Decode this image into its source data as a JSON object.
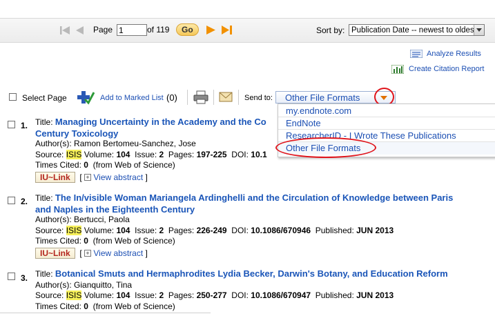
{
  "pagination": {
    "page_label": "Page",
    "page_value": "1",
    "of_label": "of 119",
    "go_label": "Go"
  },
  "sort": {
    "label": "Sort by:",
    "selected": "Publication Date -- newest to oldest"
  },
  "tools": {
    "analyze_results": "Analyze Results",
    "create_citation_report": "Create Citation Report"
  },
  "toolbar": {
    "select_page": "Select Page",
    "add_to_marked_list": "Add to Marked List",
    "marked_count": "(0)",
    "send_to_label": "Send to:",
    "send_to_value": "Other File Formats"
  },
  "send_to_menu": {
    "items": [
      "my.endnote.com",
      "EndNote",
      "ResearcherID - I Wrote These Publications",
      "Other File Formats"
    ]
  },
  "results": [
    {
      "number": "1.",
      "title_label": "Title:",
      "title_line1": "Managing Uncertainty in the Academy and the Co",
      "title_line2": "Century Toxicology",
      "authors_label": "Author(s):",
      "authors": "Ramon Bertomeu-Sanchez, Jose",
      "source_label": "Source:",
      "source": "ISIS",
      "volume_label": "Volume:",
      "volume": "104",
      "issue_label": "Issue:",
      "issue": "2",
      "pages_label": "Pages:",
      "pages": "197-225",
      "doi_label": "DOI:",
      "doi": "10.1",
      "doi_rest": "",
      "published_label": "",
      "published": "",
      "times_cited_label": "Times Cited:",
      "times_cited": "0",
      "times_cited_note": "(from Web of Science)",
      "iu_link": "IU~Link",
      "view_abstract": "View abstract"
    },
    {
      "number": "2.",
      "title_label": "Title:",
      "title_line1": "The In/visible Woman Mariangela Ardinghelli and the Circulation of Knowledge between Paris",
      "title_line2": "and Naples in the Eighteenth Century",
      "authors_label": "Author(s):",
      "authors": "Bertucci, Paola",
      "source_label": "Source:",
      "source": "ISIS",
      "volume_label": "Volume:",
      "volume": "104",
      "issue_label": "Issue:",
      "issue": "2",
      "pages_label": "Pages:",
      "pages": "226-249",
      "doi_label": "DOI:",
      "doi": "10.1086/670946",
      "published_label": "Published:",
      "published": "JUN 2013",
      "times_cited_label": "Times Cited:",
      "times_cited": "0",
      "times_cited_note": "(from Web of Science)",
      "iu_link": "IU~Link",
      "view_abstract": "View abstract"
    },
    {
      "number": "3.",
      "title_label": "Title:",
      "title_line1": "Botanical Smuts and Hermaphrodites Lydia Becker, Darwin's Botany, and Education Reform",
      "authors_label": "Author(s):",
      "authors": "Gianquitto, Tina",
      "source_label": "Source:",
      "source": "ISIS",
      "volume_label": "Volume:",
      "volume": "104",
      "issue_label": "Issue:",
      "issue": "2",
      "pages_label": "Pages:",
      "pages": "250-277",
      "doi_label": "DOI:",
      "doi": "10.1086/670947",
      "published_label": "Published:",
      "published": "JUN 2013",
      "times_cited_label": "Times Cited:",
      "times_cited": "0",
      "times_cited_note": "(from Web of Science)"
    }
  ],
  "colors": {
    "link": "#1c4fb3",
    "annotation_red": "#e0141b",
    "highlight": "#f6f05a",
    "nav_orange": "#f29100"
  }
}
